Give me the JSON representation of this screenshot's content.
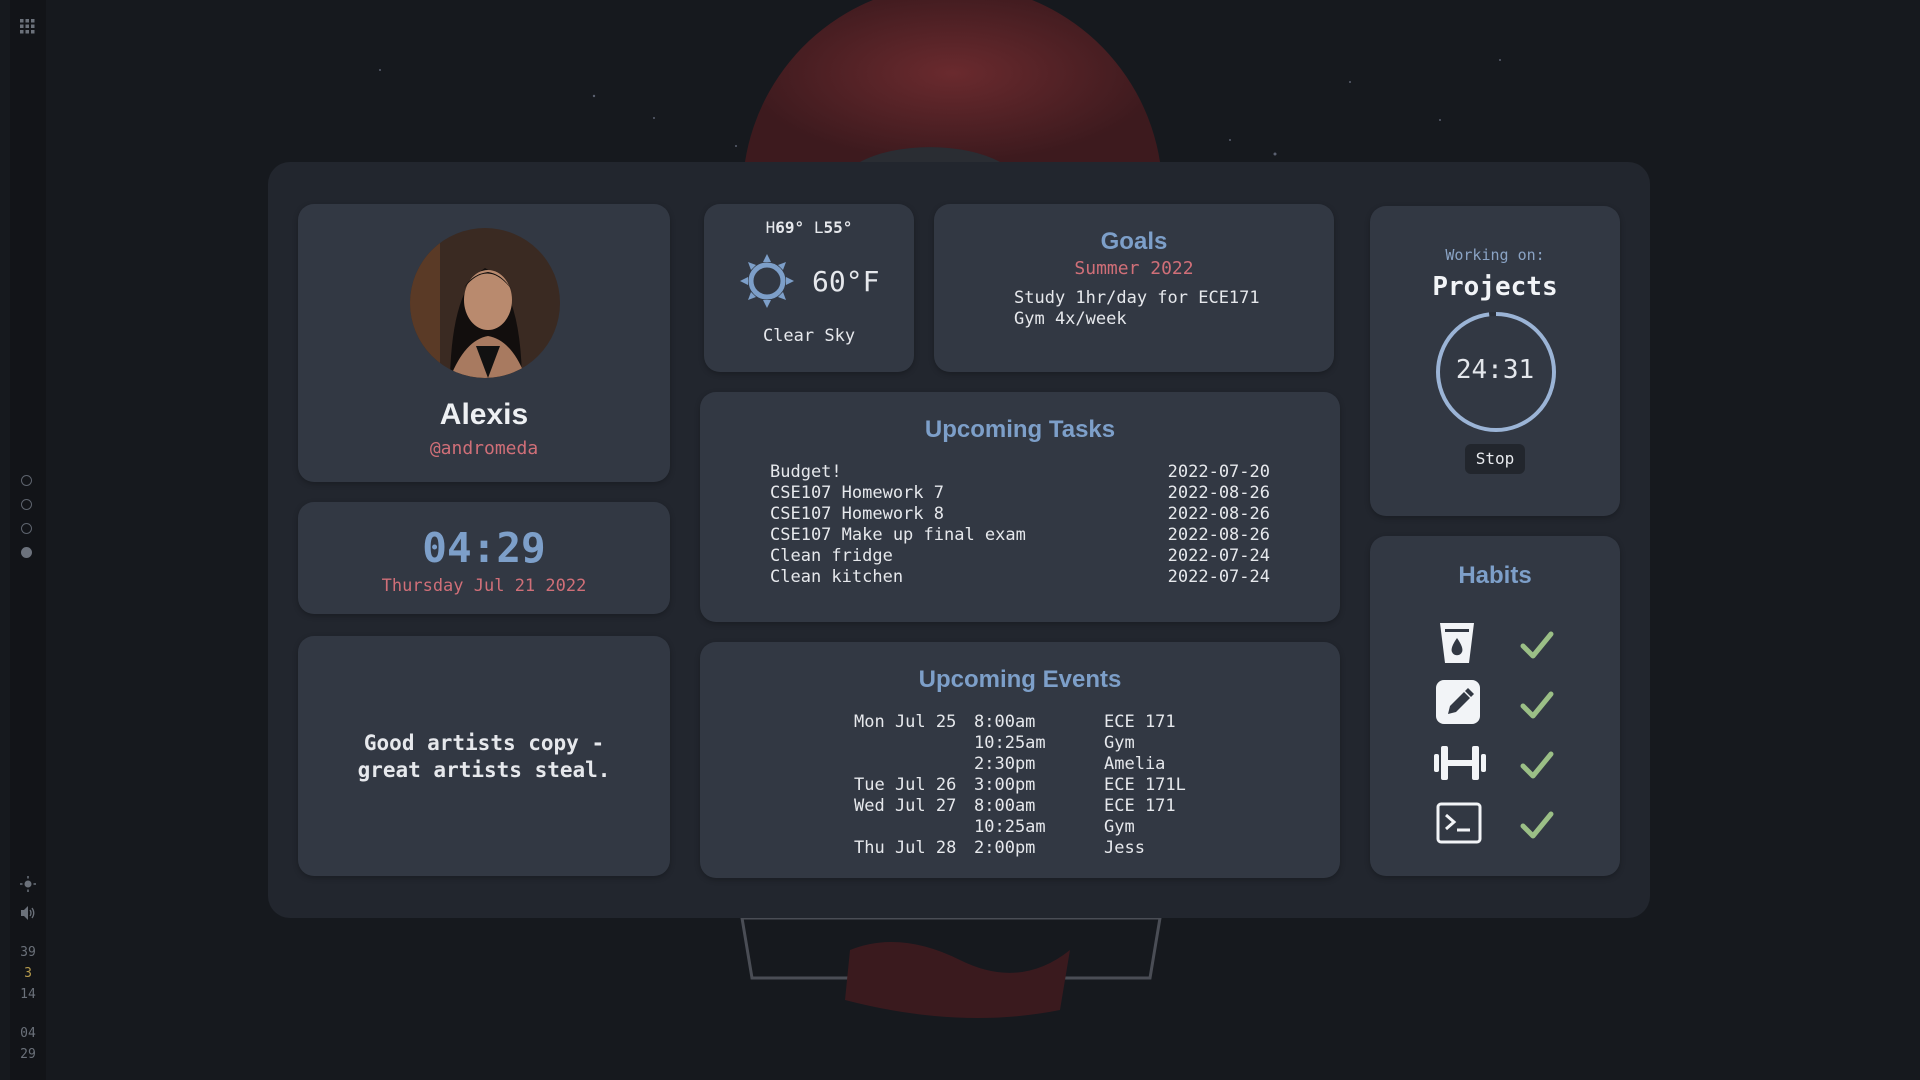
{
  "sidebar": {
    "workspaces": [
      false,
      false,
      false,
      true
    ],
    "stats": [
      "39",
      "3",
      "14"
    ],
    "time": [
      "04",
      "29"
    ]
  },
  "profile": {
    "name": "Alexis",
    "handle": "@andromeda"
  },
  "clock": {
    "time": "04:29",
    "date": "Thursday Jul 21 2022"
  },
  "quote": {
    "text": "Good artists copy -\ngreat artists steal."
  },
  "weather": {
    "high_prefix": "H",
    "high": "69°",
    "low_prefix": "L",
    "low": "55°",
    "temp": "60°F",
    "description": "Clear Sky",
    "icon": "sun-icon"
  },
  "goals": {
    "title": "Goals",
    "subtitle": "Summer 2022",
    "items": [
      "Study 1hr/day for ECE171",
      "Gym 4x/week"
    ]
  },
  "tasks": {
    "title": "Upcoming Tasks",
    "items": [
      {
        "name": "Budget!",
        "date": "2022-07-20"
      },
      {
        "name": "CSE107 Homework 7",
        "date": "2022-08-26"
      },
      {
        "name": "CSE107 Homework 8",
        "date": "2022-08-26"
      },
      {
        "name": "CSE107 Make up final exam",
        "date": "2022-08-26"
      },
      {
        "name": "Clean fridge",
        "date": "2022-07-24"
      },
      {
        "name": "Clean kitchen",
        "date": "2022-07-24"
      }
    ]
  },
  "events": {
    "title": "Upcoming Events",
    "items": [
      {
        "day": "Mon Jul 25",
        "time": "8:00am",
        "name": "ECE 171"
      },
      {
        "day": "",
        "time": "10:25am",
        "name": "Gym"
      },
      {
        "day": "",
        "time": "2:30pm",
        "name": "Amelia"
      },
      {
        "day": "Tue Jul 26",
        "time": "3:00pm",
        "name": "ECE 171L"
      },
      {
        "day": "Wed Jul 27",
        "time": "8:00am",
        "name": "ECE 171"
      },
      {
        "day": "",
        "time": "10:25am",
        "name": "Gym"
      },
      {
        "day": "Thu Jul 28",
        "time": "2:00pm",
        "name": "Jess"
      }
    ]
  },
  "timer": {
    "label": "Working on:",
    "project": "Projects",
    "value": "24:31",
    "progress": 0.98,
    "stop_label": "Stop"
  },
  "habits": {
    "title": "Habits",
    "items": [
      {
        "icon": "water-cup-icon",
        "done": true
      },
      {
        "icon": "pencil-icon",
        "done": true
      },
      {
        "icon": "dumbbell-icon",
        "done": true
      },
      {
        "icon": "terminal-icon",
        "done": true
      }
    ]
  },
  "colors": {
    "accent": "#7d9fc9",
    "pink": "#d06f78",
    "check": "#9bbf86",
    "card": "#323843",
    "panel": "#22262e"
  }
}
